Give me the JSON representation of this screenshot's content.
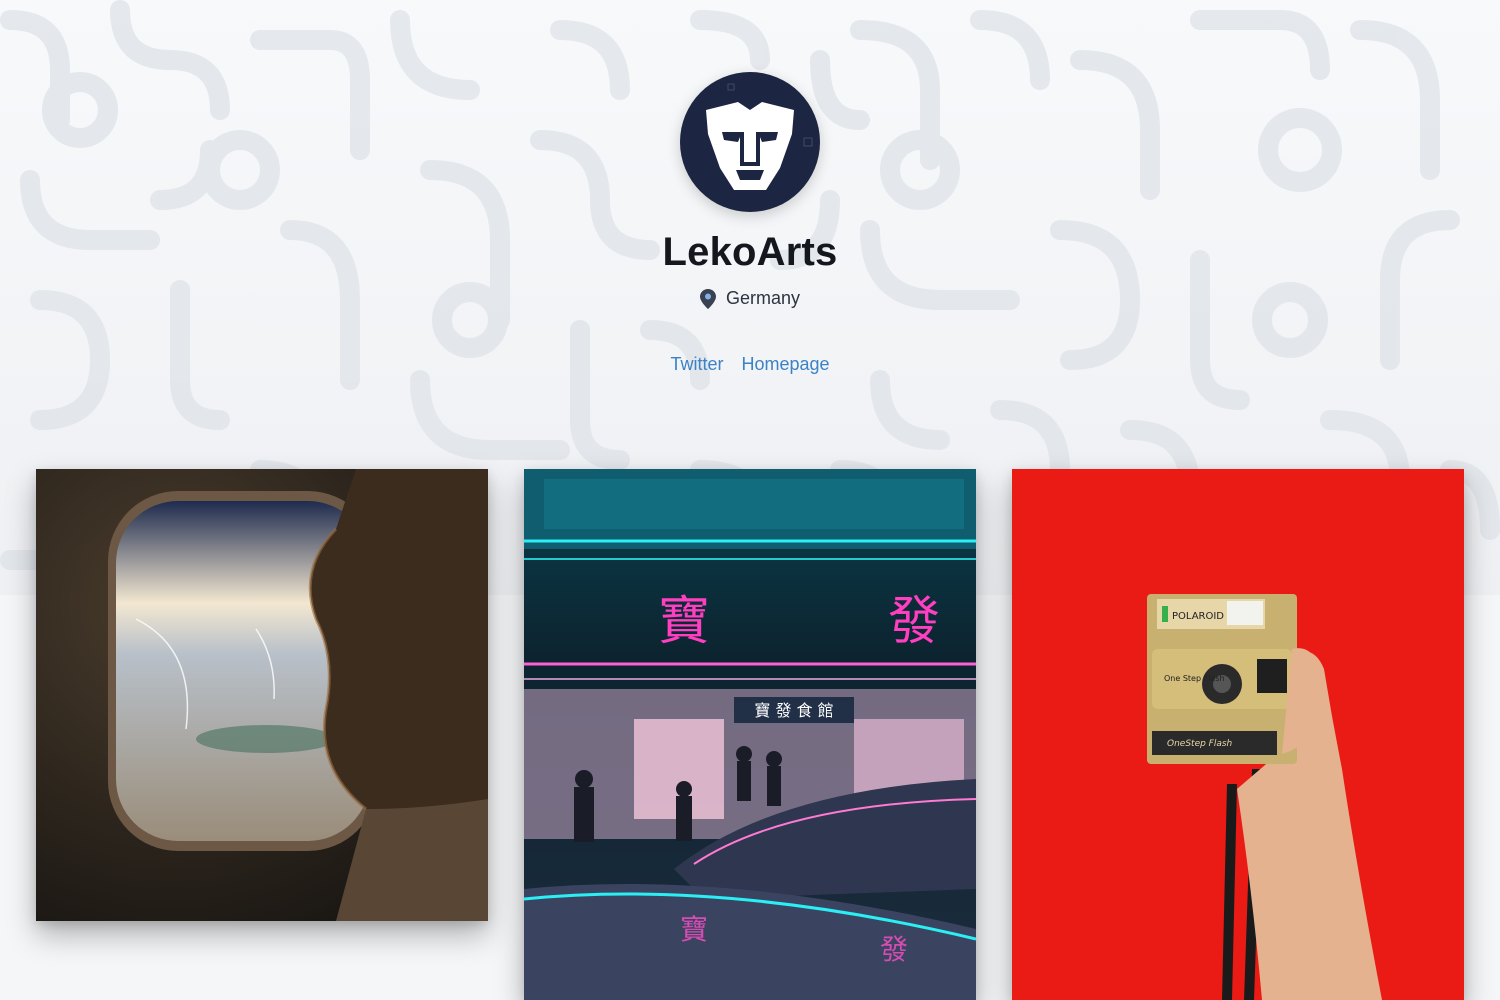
{
  "profile": {
    "name": "LekoArts",
    "location": "Germany",
    "avatar_icon": "lion-head-icon",
    "avatar_bg": "#1c2541",
    "location_icon": "map-pin-icon"
  },
  "links": [
    {
      "label": "Twitter"
    },
    {
      "label": "Homepage"
    }
  ],
  "theme": {
    "link_color": "#3b82c6",
    "title_color": "#14171d",
    "background": "#f5f6f8"
  },
  "gallery": {
    "items": [
      {
        "subject": "airplane-window-earth-photo",
        "dominant_color": "#3a2f22"
      },
      {
        "subject": "neon-night-street-photo",
        "dominant_color": "#0f5d6e",
        "sign_text": [
          "寶",
          "發",
          "寶 發 食 館"
        ]
      },
      {
        "subject": "polaroid-camera-in-hand-photo",
        "dominant_color": "#ea1a14",
        "camera_text": [
          "POLAROID",
          "One Step Flash",
          "OneStep Flash"
        ]
      }
    ]
  }
}
